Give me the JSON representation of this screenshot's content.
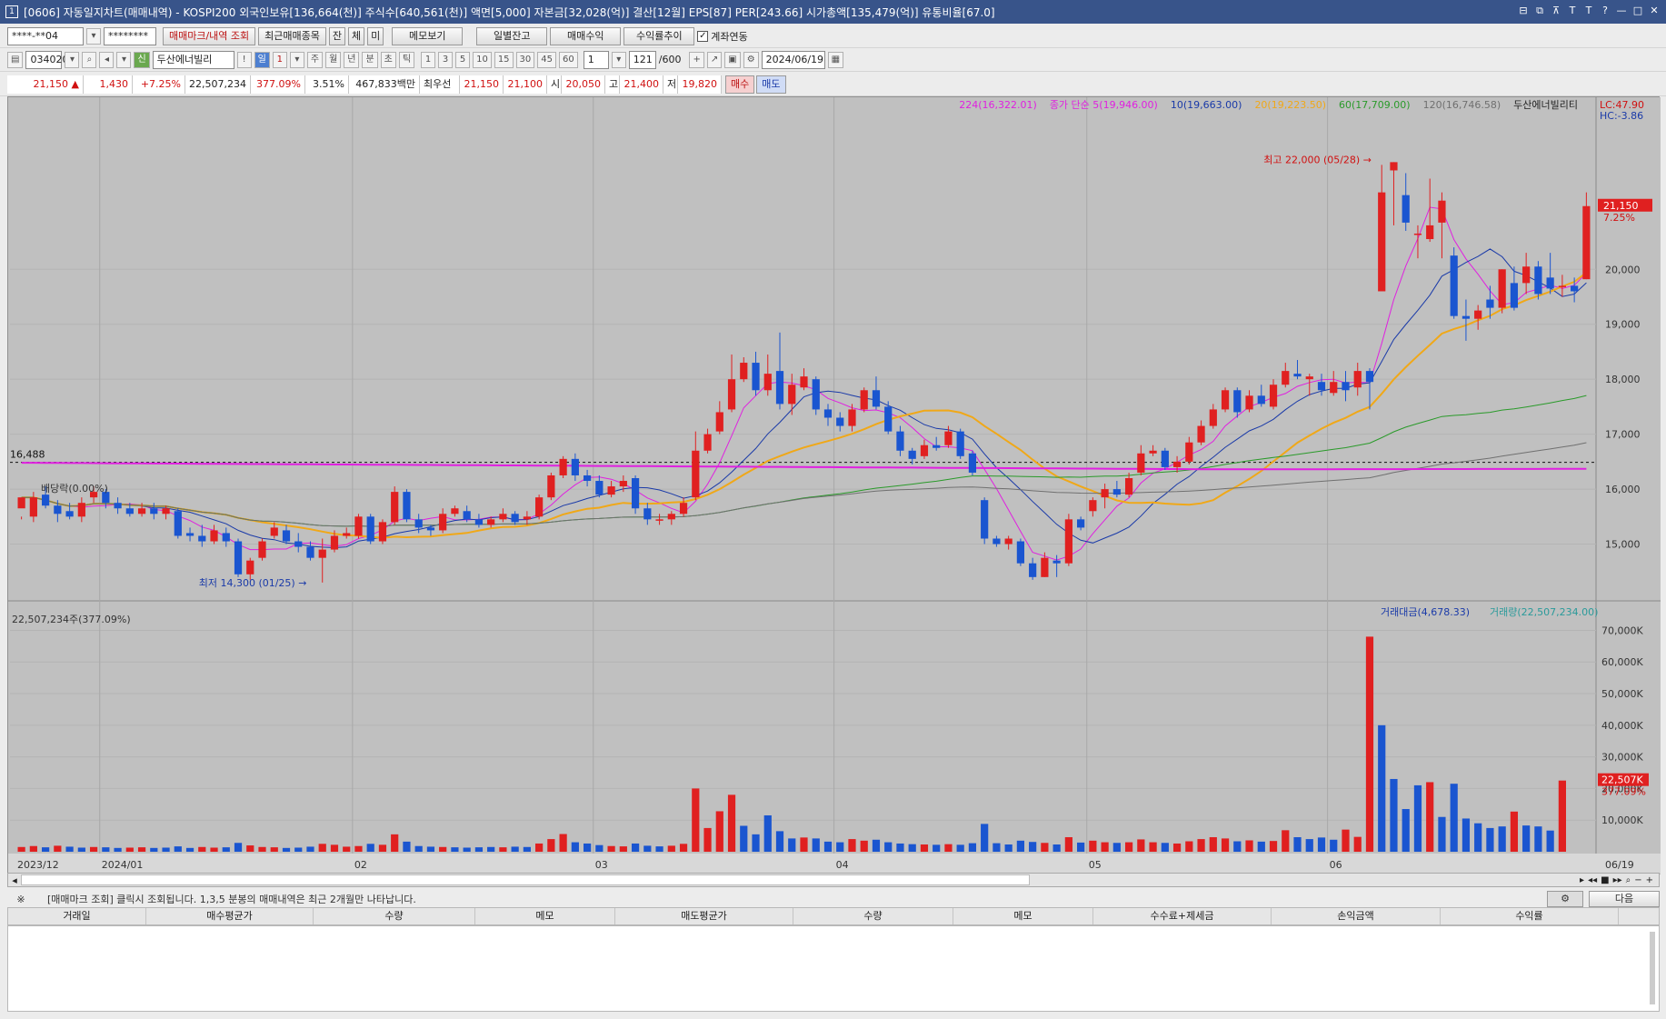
{
  "window": {
    "icon_label": "1",
    "title": "[0606] 자동일지차트(매매내역) - KOSPI200 외국인보유[136,664(천)] 주식수[640,561(천)] 액면[5,000] 자본금[32,028(억)] 결산[12월] EPS[87] PER[243.66] 시가총액[135,479(억)] 유통비율[67.0]",
    "controls": [
      "⊟",
      "⧉",
      "⊼",
      "T",
      "T",
      "?",
      "—",
      "□",
      "✕"
    ]
  },
  "row1": {
    "account": "****-**04",
    "password": "********",
    "btn_trade_mark": "매매마크/내역 조회",
    "btn_recent": "최근매매종목",
    "btn_jan": "잔",
    "btn_che": "체",
    "btn_mi": "미",
    "btn_memo": "메모보기",
    "btn_daily": "일별잔고",
    "btn_profit": "매매수익",
    "btn_return": "수익률추이",
    "chk_account_link": "계좌연동"
  },
  "row2": {
    "code": "034020",
    "name_badge": "신",
    "name": "두산에너빌리",
    "periods": [
      "!",
      "일",
      "1",
      "주",
      "월",
      "년",
      "분",
      "초",
      "틱"
    ],
    "minutes": [
      "1",
      "3",
      "5",
      "10",
      "15",
      "30",
      "45",
      "60"
    ],
    "interval": "1",
    "count": "121",
    "max_count": "/600",
    "date": "2024/06/19"
  },
  "row3": {
    "price": "21,150",
    "arrow": "▲",
    "change": "1,430",
    "change_pct": "+7.25%",
    "volume": "22,507,234",
    "vol_ratio": "377.09%",
    "turnover": "3.51%",
    "amount": "467,833백만",
    "pref_label": "최우선",
    "ask": "21,150",
    "bid": "21,100",
    "open_label": "시",
    "open": "20,050",
    "high_label": "고",
    "high": "21,400",
    "low_label": "저",
    "low": "19,820",
    "buy_btn": "매수",
    "sell_btn": "매도"
  },
  "chart_data": {
    "type": "candlestick",
    "dates_label": [
      "2023/12",
      "2024/01",
      "02",
      "03",
      "04",
      "05",
      "06",
      "06/19"
    ],
    "price_ticks": [
      "15,000",
      "16,000",
      "17,000",
      "18,000",
      "19,000",
      "20,000"
    ],
    "volume_ticks": [
      "10,000K",
      "20,000K",
      "30,000K",
      "40,000K",
      "50,000K",
      "60,000K",
      "70,000K"
    ],
    "legend_ma": [
      {
        "text": "224(16,322.01)",
        "color": "#e020e0"
      },
      {
        "text": "종가 단순 5(19,946.00)",
        "color": "#e020e0"
      },
      {
        "text": "10(19,663.00)",
        "color": "#1a3aa8"
      },
      {
        "text": "20(19,223.50)",
        "color": "#f0a818"
      },
      {
        "text": "60(17,709.00)",
        "color": "#2a9a2a"
      },
      {
        "text": "120(16,746.58)",
        "color": "#707070"
      },
      {
        "text": "두산에너빌리티",
        "color": "#222222"
      }
    ],
    "lc": "LC:47.90",
    "hc": "HC:-3.86",
    "high_note": "최고 22,000 (05/28)",
    "low_note": "최저 14,300 (01/25)",
    "ref_line_value": "16,488",
    "dividend_note": "배당락(0.00%)",
    "last_price_tag": "21,150",
    "last_pct_tag": "7.25%",
    "vol_legend_amount": "거래대금(4,678.33)",
    "vol_legend_volume": "거래량(22,507,234.00)",
    "vol_note": "22,507,234주(377.09%)",
    "vol_last_tag": "22,507K",
    "vol_last_pct": "377.09%",
    "candles": [
      [
        15650,
        15850,
        15500,
        15450
      ],
      [
        15500,
        15850,
        15950,
        15400
      ],
      [
        15900,
        15700,
        16050,
        15650
      ],
      [
        15700,
        15550,
        15800,
        15400
      ],
      [
        15600,
        15500,
        15750,
        15450
      ],
      [
        15500,
        15750,
        15850,
        15400
      ],
      [
        15850,
        15950,
        16050,
        15750
      ],
      [
        15950,
        15750,
        16000,
        15650
      ],
      [
        15750,
        15650,
        15850,
        15550
      ],
      [
        15650,
        15550,
        15750,
        15500
      ],
      [
        15550,
        15650,
        15750,
        15500
      ],
      [
        15650,
        15550,
        15750,
        15450
      ],
      [
        15550,
        15650,
        15700,
        15450
      ],
      [
        15600,
        15150,
        15650,
        15100
      ],
      [
        15200,
        15150,
        15300,
        15050
      ],
      [
        15150,
        15050,
        15350,
        14950
      ],
      [
        15050,
        15250,
        15350,
        15000
      ],
      [
        15200,
        15050,
        15300,
        14950
      ],
      [
        15050,
        14450,
        15100,
        14400
      ],
      [
        14450,
        14700,
        14750,
        14350
      ],
      [
        14750,
        15050,
        15100,
        14700
      ],
      [
        15150,
        15300,
        15400,
        15100
      ],
      [
        15250,
        15050,
        15350,
        15000
      ],
      [
        15050,
        14950,
        15200,
        14850
      ],
      [
        14950,
        14750,
        15050,
        14700
      ],
      [
        14750,
        14900,
        15100,
        14300
      ],
      [
        14900,
        15150,
        15250,
        14850
      ],
      [
        15150,
        15200,
        15300,
        15100
      ],
      [
        15150,
        15500,
        15550,
        15100
      ],
      [
        15500,
        15050,
        15550,
        15000
      ],
      [
        15050,
        15400,
        15450,
        15000
      ],
      [
        15400,
        15950,
        16050,
        15350
      ],
      [
        15950,
        15450,
        16000,
        15400
      ],
      [
        15450,
        15300,
        15550,
        15200
      ],
      [
        15300,
        15250,
        15350,
        15150
      ],
      [
        15250,
        15550,
        15650,
        15200
      ],
      [
        15550,
        15650,
        15700,
        15500
      ],
      [
        15600,
        15450,
        15700,
        15400
      ],
      [
        15450,
        15350,
        15550,
        15300
      ],
      [
        15350,
        15450,
        15500,
        15300
      ],
      [
        15450,
        15550,
        15650,
        15400
      ],
      [
        15550,
        15400,
        15600,
        15350
      ],
      [
        15450,
        15500,
        15600,
        15350
      ],
      [
        15500,
        15850,
        15900,
        15450
      ],
      [
        15850,
        16250,
        16300,
        15800
      ],
      [
        16250,
        16550,
        16600,
        16200
      ],
      [
        16550,
        16250,
        16650,
        16150
      ],
      [
        16250,
        16150,
        16350,
        16050
      ],
      [
        16150,
        15900,
        16250,
        15850
      ],
      [
        15900,
        16050,
        16150,
        15850
      ],
      [
        16050,
        16150,
        16250,
        15950
      ],
      [
        16200,
        15650,
        16250,
        15550
      ],
      [
        15650,
        15450,
        15750,
        15350
      ],
      [
        15450,
        15450,
        15550,
        15350
      ],
      [
        15450,
        15550,
        15600,
        15350
      ],
      [
        15550,
        15750,
        15850,
        15500
      ],
      [
        15850,
        16700,
        17050,
        15800
      ],
      [
        16700,
        17000,
        17100,
        16650
      ],
      [
        17050,
        17400,
        17600,
        17000
      ],
      [
        17450,
        18000,
        18450,
        17400
      ],
      [
        18000,
        18300,
        18400,
        17950
      ],
      [
        18300,
        17800,
        18500,
        17700
      ],
      [
        17800,
        18100,
        18450,
        17700
      ],
      [
        18150,
        17550,
        18850,
        17450
      ],
      [
        17550,
        17900,
        18100,
        17350
      ],
      [
        17850,
        18050,
        18200,
        17800
      ],
      [
        18000,
        17450,
        18050,
        17350
      ],
      [
        17450,
        17300,
        17550,
        17150
      ],
      [
        17300,
        17150,
        17400,
        17050
      ],
      [
        17150,
        17450,
        17550,
        17050
      ],
      [
        17450,
        17800,
        17850,
        17400
      ],
      [
        17800,
        17500,
        18050,
        17450
      ],
      [
        17500,
        17050,
        17600,
        17000
      ],
      [
        17050,
        16700,
        17150,
        16600
      ],
      [
        16700,
        16550,
        16750,
        16450
      ],
      [
        16600,
        16800,
        16900,
        16550
      ],
      [
        16800,
        16750,
        16950,
        16700
      ],
      [
        16800,
        17050,
        17150,
        16750
      ],
      [
        17050,
        16600,
        17100,
        16550
      ],
      [
        16650,
        16300,
        16700,
        16250
      ],
      [
        15800,
        15100,
        15850,
        15000
      ],
      [
        15100,
        15000,
        15150,
        14950
      ],
      [
        15000,
        15100,
        15150,
        14900
      ],
      [
        15050,
        14650,
        15100,
        14600
      ],
      [
        14650,
        14400,
        14750,
        14350
      ],
      [
        14400,
        14750,
        14850,
        14400
      ],
      [
        14700,
        14650,
        14800,
        14400
      ],
      [
        14650,
        15450,
        15550,
        14600
      ],
      [
        15450,
        15300,
        15500,
        15250
      ],
      [
        15600,
        15800,
        15850,
        15500
      ],
      [
        15850,
        16000,
        16100,
        15650
      ],
      [
        16000,
        15900,
        16150,
        15850
      ],
      [
        15900,
        16200,
        16300,
        15850
      ],
      [
        16300,
        16650,
        16800,
        16250
      ],
      [
        16650,
        16700,
        16800,
        16600
      ],
      [
        16700,
        16400,
        16750,
        16350
      ],
      [
        16400,
        16500,
        16600,
        16300
      ],
      [
        16500,
        16850,
        16950,
        16450
      ],
      [
        16850,
        17150,
        17250,
        16800
      ],
      [
        17150,
        17450,
        17550,
        17100
      ],
      [
        17450,
        17800,
        17850,
        17400
      ],
      [
        17800,
        17400,
        17850,
        17300
      ],
      [
        17450,
        17700,
        17800,
        17400
      ],
      [
        17700,
        17550,
        17900,
        17500
      ],
      [
        17500,
        17900,
        18000,
        17450
      ],
      [
        17900,
        18150,
        18300,
        17850
      ],
      [
        18100,
        18050,
        18350,
        18000
      ],
      [
        18000,
        18050,
        18100,
        17700
      ],
      [
        17950,
        17800,
        18100,
        17700
      ],
      [
        17750,
        17950,
        18150,
        17700
      ],
      [
        17950,
        17800,
        18150,
        17600
      ],
      [
        17850,
        18150,
        18300,
        17700
      ],
      [
        18150,
        17950,
        18200,
        17450
      ],
      [
        19600,
        21400,
        21900,
        19700
      ],
      [
        21800,
        21950,
        21950,
        20800
      ],
      [
        21350,
        20850,
        21750,
        20700
      ],
      [
        20650,
        20650,
        20800,
        20200
      ],
      [
        20550,
        20800,
        21650,
        20500
      ],
      [
        20850,
        21250,
        21400,
        20200
      ],
      [
        20250,
        19150,
        20400,
        19100
      ],
      [
        19150,
        19100,
        19450,
        18700
      ],
      [
        19100,
        19250,
        19350,
        18900
      ],
      [
        19450,
        19300,
        19700,
        19100
      ],
      [
        19300,
        20000,
        20000,
        19200
      ],
      [
        19750,
        19300,
        20050,
        19250
      ],
      [
        19750,
        20050,
        20300,
        19550
      ],
      [
        20050,
        19550,
        20150,
        19450
      ],
      [
        19850,
        19650,
        20300,
        19550
      ],
      [
        19700,
        19700,
        19900,
        19500
      ],
      [
        19700,
        19600,
        19850,
        19400
      ],
      [
        19820,
        21150,
        21400,
        19820
      ]
    ],
    "volumes": [
      [
        1500,
        1
      ],
      [
        1800,
        1
      ],
      [
        1400,
        0
      ],
      [
        1900,
        1
      ],
      [
        1600,
        0
      ],
      [
        1300,
        0
      ],
      [
        1500,
        1
      ],
      [
        1400,
        0
      ],
      [
        1200,
        0
      ],
      [
        1300,
        1
      ],
      [
        1400,
        1
      ],
      [
        1200,
        0
      ],
      [
        1300,
        0
      ],
      [
        1700,
        0
      ],
      [
        1200,
        0
      ],
      [
        1500,
        1
      ],
      [
        1300,
        1
      ],
      [
        1400,
        0
      ],
      [
        2800,
        0
      ],
      [
        2000,
        1
      ],
      [
        1500,
        1
      ],
      [
        1400,
        1
      ],
      [
        1200,
        0
      ],
      [
        1300,
        0
      ],
      [
        1600,
        0
      ],
      [
        2500,
        1
      ],
      [
        2200,
        1
      ],
      [
        1600,
        1
      ],
      [
        1800,
        1
      ],
      [
        2500,
        0
      ],
      [
        2200,
        1
      ],
      [
        5500,
        1
      ],
      [
        3200,
        0
      ],
      [
        1800,
        0
      ],
      [
        1600,
        0
      ],
      [
        1500,
        1
      ],
      [
        1400,
        0
      ],
      [
        1300,
        0
      ],
      [
        1400,
        0
      ],
      [
        1500,
        0
      ],
      [
        1400,
        1
      ],
      [
        1600,
        0
      ],
      [
        1500,
        0
      ],
      [
        2600,
        1
      ],
      [
        4000,
        1
      ],
      [
        5600,
        1
      ],
      [
        3000,
        0
      ],
      [
        2600,
        0
      ],
      [
        2100,
        0
      ],
      [
        1800,
        1
      ],
      [
        1700,
        1
      ],
      [
        2600,
        0
      ],
      [
        1900,
        0
      ],
      [
        1700,
        0
      ],
      [
        1900,
        1
      ],
      [
        2500,
        1
      ],
      [
        20000,
        1
      ],
      [
        7500,
        1
      ],
      [
        12800,
        1
      ],
      [
        18000,
        1
      ],
      [
        8200,
        0
      ],
      [
        5500,
        0
      ],
      [
        11500,
        0
      ],
      [
        6500,
        0
      ],
      [
        4200,
        0
      ],
      [
        4500,
        1
      ],
      [
        4200,
        0
      ],
      [
        3200,
        0
      ],
      [
        3000,
        0
      ],
      [
        4000,
        1
      ],
      [
        3500,
        1
      ],
      [
        3800,
        0
      ],
      [
        3000,
        0
      ],
      [
        2600,
        0
      ],
      [
        2400,
        0
      ],
      [
        2300,
        1
      ],
      [
        2200,
        0
      ],
      [
        2400,
        1
      ],
      [
        2200,
        0
      ],
      [
        2700,
        0
      ],
      [
        8800,
        0
      ],
      [
        2700,
        0
      ],
      [
        2300,
        0
      ],
      [
        3500,
        0
      ],
      [
        3100,
        0
      ],
      [
        2800,
        1
      ],
      [
        2300,
        0
      ],
      [
        4600,
        1
      ],
      [
        2900,
        0
      ],
      [
        3500,
        1
      ],
      [
        3000,
        1
      ],
      [
        2800,
        0
      ],
      [
        3000,
        1
      ],
      [
        3900,
        1
      ],
      [
        3000,
        1
      ],
      [
        2800,
        0
      ],
      [
        2600,
        1
      ],
      [
        3300,
        1
      ],
      [
        4000,
        1
      ],
      [
        4600,
        1
      ],
      [
        4200,
        1
      ],
      [
        3300,
        0
      ],
      [
        3600,
        1
      ],
      [
        3200,
        0
      ],
      [
        3400,
        1
      ],
      [
        6800,
        1
      ],
      [
        4600,
        0
      ],
      [
        4000,
        0
      ],
      [
        4500,
        0
      ],
      [
        3800,
        0
      ],
      [
        7000,
        1
      ],
      [
        4700,
        1
      ],
      [
        68000,
        1
      ],
      [
        40000,
        0
      ],
      [
        23000,
        0
      ],
      [
        13500,
        0
      ],
      [
        21000,
        0
      ],
      [
        22000,
        1
      ],
      [
        11000,
        0
      ],
      [
        21500,
        0
      ],
      [
        10500,
        0
      ],
      [
        9000,
        0
      ],
      [
        7500,
        0
      ],
      [
        8000,
        0
      ],
      [
        12700,
        1
      ],
      [
        8300,
        0
      ],
      [
        8000,
        0
      ],
      [
        6700,
        0
      ],
      [
        22507,
        1
      ]
    ]
  },
  "status": {
    "mark": "※",
    "message": "[매매마크 조회] 클릭시 조회됩니다. 1,3,5 분봉의 매매내역은 최근 2개월만 나타납니다.",
    "next_btn": "다음"
  },
  "grid_headers": [
    "거래일",
    "매수평균가",
    "수량",
    "메모",
    "매도평균가",
    "수량",
    "메모",
    "수수료+제세금",
    "손익금액",
    "수익률"
  ]
}
